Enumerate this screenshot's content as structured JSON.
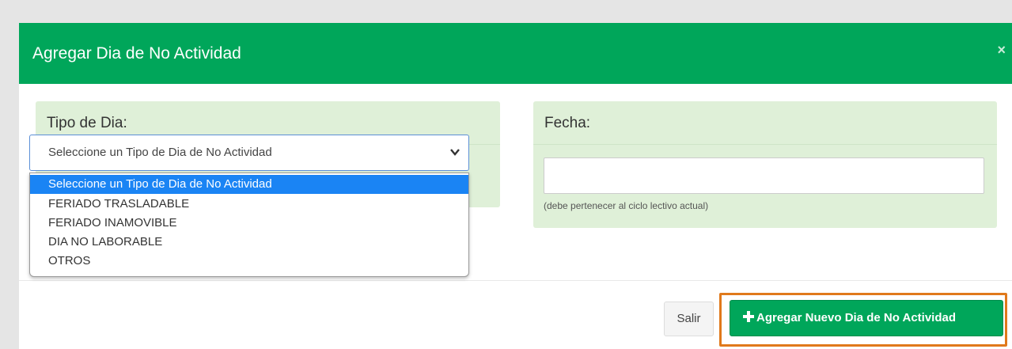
{
  "modal": {
    "title": "Agregar Dia de No Actividad",
    "close_symbol": "×"
  },
  "tipo_panel": {
    "label": "Tipo de Dia:",
    "select": {
      "selected_value": "Seleccione un Tipo de Dia de No Actividad",
      "options": [
        "Seleccione un Tipo de Dia de No Actividad",
        "FERIADO TRASLADABLE",
        "FERIADO INAMOVIBLE",
        "DIA NO LABORABLE",
        "OTROS"
      ],
      "highlighted_index": 0
    }
  },
  "fecha_panel": {
    "label": "Fecha:",
    "input_value": "",
    "help_text": "(debe pertenecer al ciclo lectivo actual)"
  },
  "footer": {
    "exit_label": "Salir",
    "add_label": "Agregar Nuevo Dia de No Actividad",
    "add_icon": "plus-icon"
  },
  "colors": {
    "header_green": "#00a65a",
    "panel_bg": "#dff0d8",
    "option_highlight": "#1a84f4",
    "annotation_orange": "#e0791b"
  }
}
